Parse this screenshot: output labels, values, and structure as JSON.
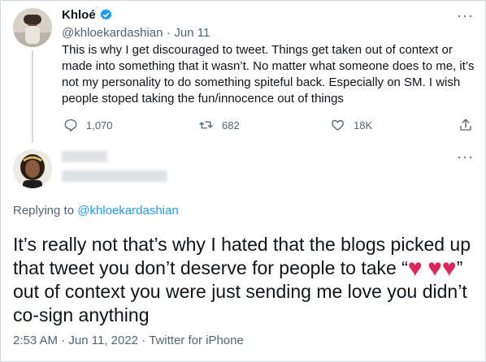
{
  "parent_tweet": {
    "author_name": "Khloé",
    "verified_icon": "verified-badge-icon",
    "handle": "@khloekardashian",
    "separator": "·",
    "date": "Jun 11",
    "text": "This is why I get discouraged to tweet. Things get taken out of context or made into something that it wasn’t. No matter what someone does to me, it’s not my personality to do something spiteful back. Especially on SM. I wish people stoped taking the fun/innocence out of things",
    "reply_count": "1,070",
    "retweet_count": "682",
    "like_count": "18K",
    "more": "···"
  },
  "reply_tweet": {
    "more": "···",
    "replying_to_label": "Replying to",
    "replying_to_handle": "@khloekardashian",
    "text_part1": "It’s really not that’s why I hated that the blogs picked up that tweet you don’t deserve for people to take “",
    "heart_emoji": "❤️",
    "text_part2": "” out of context you were just sending me love you didn’t co-sign anything",
    "time": "2:53 AM",
    "separator1": "·",
    "date": "Jun 11, 2022",
    "separator2": "·",
    "source": "Twitter for iPhone"
  },
  "colors": {
    "accent": "#1d9bf0",
    "verified": "#1d9bf0",
    "heart": "#e0245e",
    "muted": "#536471",
    "border": "#cfd9de"
  }
}
